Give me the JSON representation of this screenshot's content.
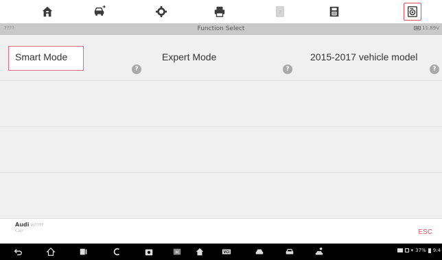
{
  "toolbar": {
    "items": [
      {
        "icon": "home-icon"
      },
      {
        "icon": "vehicle-swap-icon"
      },
      {
        "icon": "settings-icon"
      },
      {
        "icon": "print-icon"
      },
      {
        "icon": "help-doc-icon"
      },
      {
        "icon": "save-icon"
      },
      {
        "icon": "data-logging-icon"
      }
    ]
  },
  "titlebar": {
    "left": "????",
    "title": "Function Select",
    "battery": "11.89V"
  },
  "functions": [
    {
      "label": "Smart Mode",
      "help": "?"
    },
    {
      "label": "Expert Mode",
      "help": "?"
    },
    {
      "label": "2015-2017 vehicle model",
      "help": "?"
    }
  ],
  "info": {
    "make": "Audi",
    "sub": "V/????",
    "line2": "Can",
    "esc": "ESC"
  },
  "status": {
    "battery_pct": "37%",
    "time": "9:4"
  },
  "colors": {
    "accent": "#e0505e",
    "toolbar_bg": "#ffffff",
    "titlebar_bg": "#c9c9c9",
    "grid_bg": "#f0f0f0",
    "navbar_bg": "#000000"
  }
}
